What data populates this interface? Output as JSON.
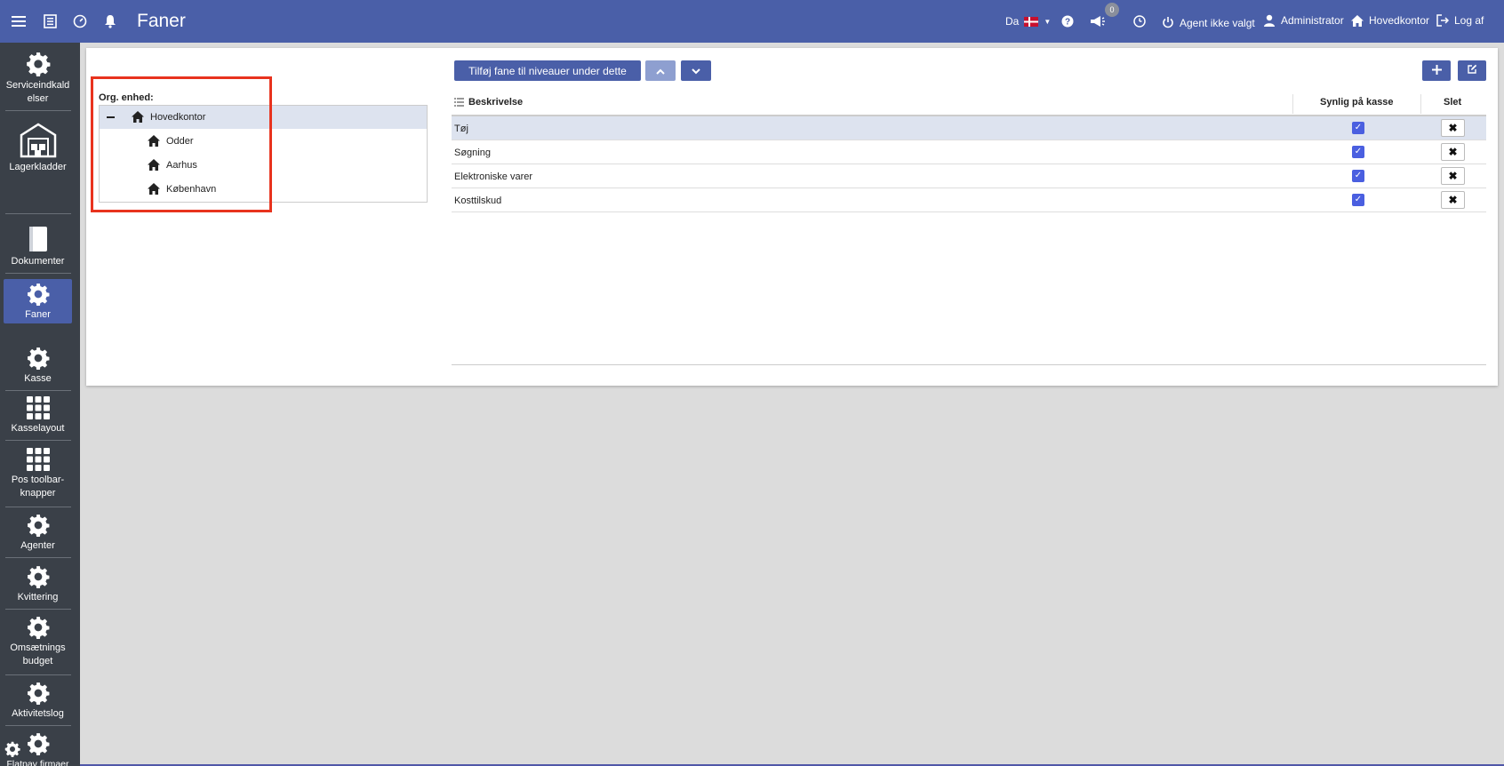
{
  "header": {
    "title": "Faner",
    "language": "Da",
    "notification_count": "0",
    "agent_label": "Agent ikke valgt",
    "user_label": "Administrator",
    "location_label": "Hovedkontor",
    "logout_label": "Log af"
  },
  "sidebar": {
    "items": [
      {
        "label": "Serviceindkald elser",
        "icon": "gear-icon"
      },
      {
        "label": "Lagerkladder",
        "icon": "warehouse-icon"
      },
      {
        "label": "Dokumenter",
        "icon": "book-icon"
      },
      {
        "label": "Faner",
        "icon": "gear-icon"
      },
      {
        "label": "Kasse",
        "icon": "gear-icon"
      },
      {
        "label": "Kasselayout",
        "icon": "grid-icon"
      },
      {
        "label": "Pos toolbar-knapper",
        "icon": "grid-icon"
      },
      {
        "label": "Agenter",
        "icon": "gear-icon"
      },
      {
        "label": "Kvittering",
        "icon": "gear-icon"
      },
      {
        "label": "Omsætnings budget",
        "icon": "gear-icon"
      },
      {
        "label": "Aktivitetslog",
        "icon": "gear-icon"
      },
      {
        "label": "Flatpay firmaer",
        "icon": "gear-icon"
      }
    ]
  },
  "org": {
    "label": "Org. enhed:",
    "root": "Hovedkontor",
    "children": [
      "Odder",
      "Aarhus",
      "København"
    ]
  },
  "toolbar": {
    "add_tab_label": "Tilføj fane til niveauer under dette"
  },
  "grid": {
    "columns": [
      "Beskrivelse",
      "Synlig på kasse",
      "Slet"
    ],
    "rows": [
      {
        "desc": "Tøj",
        "visible": true
      },
      {
        "desc": "Søgning",
        "visible": true
      },
      {
        "desc": "Elektroniske varer",
        "visible": true
      },
      {
        "desc": "Kosttilskud",
        "visible": true
      }
    ]
  }
}
